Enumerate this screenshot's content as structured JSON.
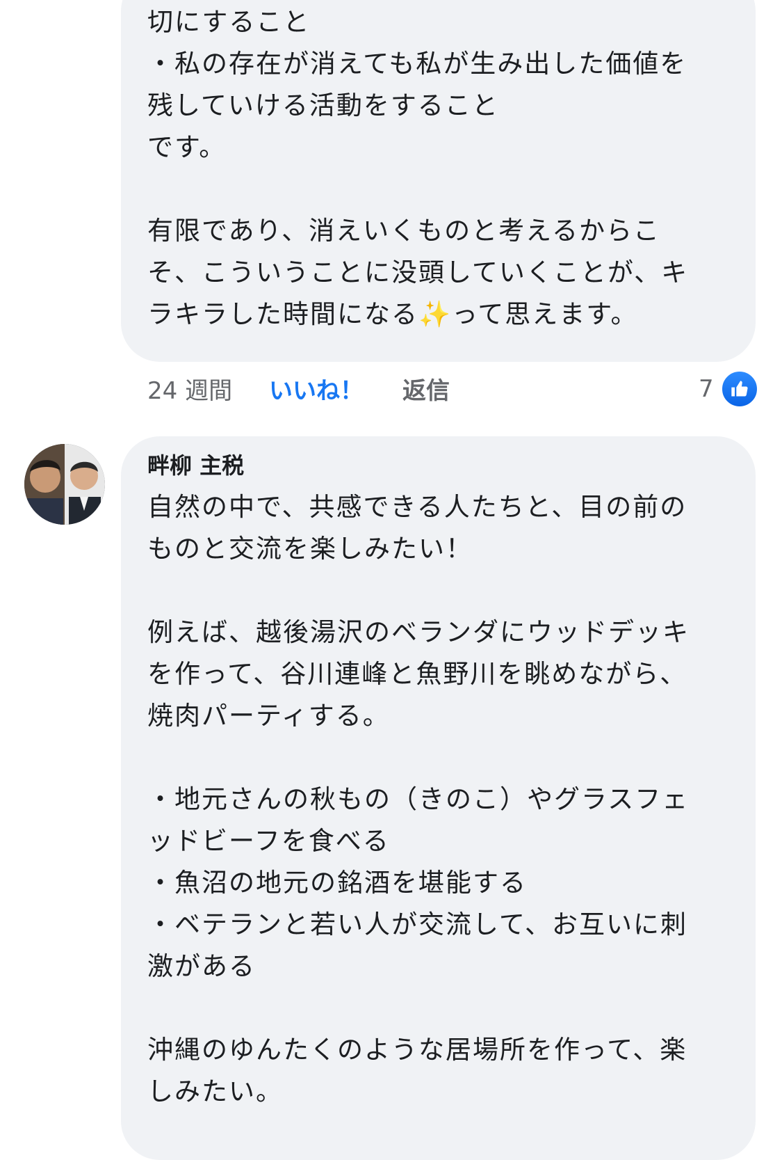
{
  "comment1": {
    "text": "切にすること\n・私の存在が消えても私が生み出した価値を\n残していける活動をすること\nです。\n\n有限であり、消えいくものと考えるからこ\nそ、こういうことに没頭していくことが、キ\nラキラした時間になる✨って思えます。",
    "time": "24 週間",
    "like_label": "いいね！",
    "reply_label": "返信",
    "reaction_count": "7",
    "reaction_icon": "thumbs-up-icon"
  },
  "comment2": {
    "author": "畔柳 主税",
    "avatar_icon": "two-person-photo",
    "text": "自然の中で、共感できる人たちと、目の前の\nものと交流を楽しみたい！\n\n例えば、越後湯沢のベランダにウッドデッキ\nを作って、谷川連峰と魚野川を眺めながら、\n焼肉パーティする。\n\n・地元さんの秋もの（きのこ）やグラスフェ\nッドビーフを食べる\n・魚沼の地元の銘酒を堪能する\n・ベテランと若い人が交流して、お互いに刺\n激がある\n\n沖縄のゆんたくのような居場所を作って、楽\nしみたい。"
  },
  "colors": {
    "bubble": "#f0f2f5",
    "text": "#1c1e21",
    "secondary": "#65676b",
    "accent": "#1877f2"
  }
}
